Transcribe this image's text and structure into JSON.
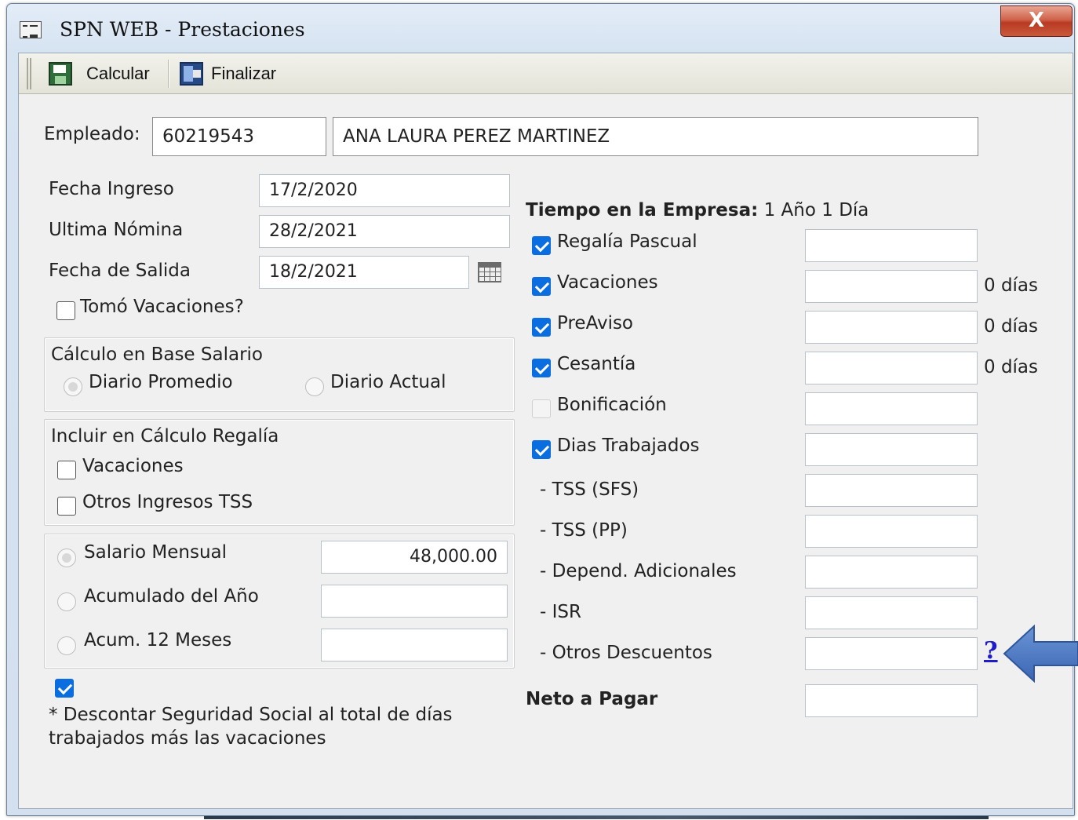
{
  "window": {
    "title": "SPN WEB - Prestaciones",
    "close_label": "X"
  },
  "toolbar": {
    "calcular": "Calcular",
    "finalizar": "Finalizar"
  },
  "employee": {
    "label": "Empleado:",
    "id": "60219543",
    "name": "ANA LAURA PEREZ MARTINEZ"
  },
  "dates": {
    "fecha_ingreso_label": "Fecha Ingreso",
    "fecha_ingreso": "17/2/2020",
    "ultima_nomina_label": "Ultima Nómina",
    "ultima_nomina": "28/2/2021",
    "fecha_salida_label": "Fecha de Salida",
    "fecha_salida": "18/2/2021"
  },
  "tomo_vacaciones": {
    "label": "Tomó Vacaciones?",
    "checked": false
  },
  "base_salario": {
    "title": "Cálculo en Base Salario",
    "diario_promedio": "Diario Promedio",
    "diario_actual": "Diario Actual",
    "selected": "diario_promedio"
  },
  "regalia": {
    "title": "Incluir en Cálculo Regalía",
    "vacaciones": "Vacaciones",
    "otros_ingresos": "Otros Ingresos TSS"
  },
  "salario": {
    "mensual_label": "Salario Mensual",
    "mensual_value": "48,000.00",
    "acumulado_label": "Acumulado del Año",
    "acumulado_value": "",
    "acum12_label": "Acum. 12 Meses",
    "acum12_value": "",
    "selected": "mensual"
  },
  "descontar": {
    "checked": true,
    "note_line1": "* Descontar Seguridad Social al total de días",
    "note_line2": "trabajados más las vacaciones"
  },
  "tiempo": {
    "label": "Tiempo en la Empresa:",
    "value": "1 Año 1 Día"
  },
  "concepts": [
    {
      "label": "Regalía Pascual",
      "checked": true,
      "value": "",
      "suffix": ""
    },
    {
      "label": "Vacaciones",
      "checked": true,
      "value": "",
      "suffix": "0 días"
    },
    {
      "label": "PreAviso",
      "checked": true,
      "value": "",
      "suffix": "0 días"
    },
    {
      "label": "Cesantía",
      "checked": true,
      "value": "",
      "suffix": "0 días"
    },
    {
      "label": "Bonificación",
      "checked": false,
      "value": "",
      "suffix": ""
    },
    {
      "label": "Dias Trabajados",
      "checked": true,
      "value": "",
      "suffix": ""
    }
  ],
  "deductions": [
    {
      "label": "- TSS (SFS)",
      "value": ""
    },
    {
      "label": "- TSS (PP)",
      "value": ""
    },
    {
      "label": "- Depend. Adicionales",
      "value": ""
    },
    {
      "label": "- ISR",
      "value": ""
    },
    {
      "label": "- Otros Descuentos",
      "value": ""
    }
  ],
  "help_link": "?",
  "neto": {
    "label": "Neto a Pagar",
    "value": ""
  },
  "colors": {
    "accent_check": "#0b6ee0",
    "arrow": "#4a78c2",
    "help_link": "#1d1dc9"
  }
}
